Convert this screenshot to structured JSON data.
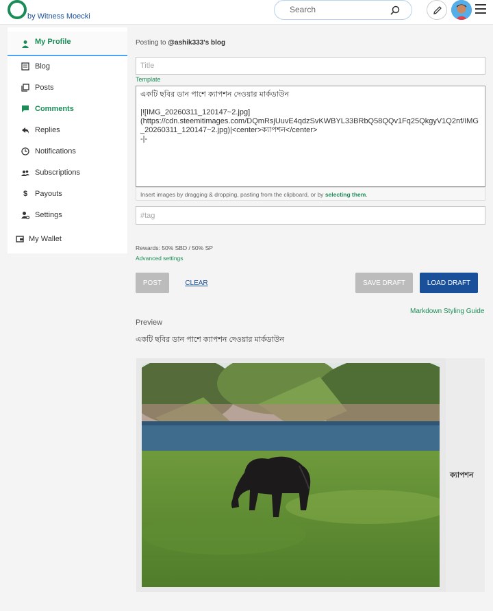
{
  "header": {
    "byline": "by Witness Moecki",
    "search_placeholder": "Search"
  },
  "sidebar": {
    "items": [
      {
        "label": "My Profile",
        "icon": "person-icon"
      },
      {
        "label": "Blog",
        "icon": "blog-icon"
      },
      {
        "label": "Posts",
        "icon": "posts-icon"
      },
      {
        "label": "Comments",
        "icon": "comment-icon"
      },
      {
        "label": "Replies",
        "icon": "reply-icon"
      },
      {
        "label": "Notifications",
        "icon": "clock-icon"
      },
      {
        "label": "Subscriptions",
        "icon": "people-icon"
      },
      {
        "label": "Payouts",
        "icon": "dollar-icon"
      },
      {
        "label": "Settings",
        "icon": "settings-icon"
      },
      {
        "label": "My Wallet",
        "icon": "wallet-icon"
      }
    ]
  },
  "editor": {
    "posting_prefix": "Posting to",
    "posting_target": "@ashik333's blog",
    "title_placeholder": "Title",
    "template_label": "Template",
    "body_text": "একটি ছবির ডান পাশে ক্যাপশন দেওয়ার মার্কডাউন\n\n|![IMG_20260311_120147~2.jpg](https://cdn.steemitimages.com/DQmRsjUuvE4qdzSvKWBYL33BRbQ58QQv1Fq25QkgyV1Q2nf/IMG_20260311_120147~2.jpg)|<center>ক্যাপশন</center>\n-|-",
    "dropzone_text": "Insert images by dragging & dropping, pasting from the clipboard, or by",
    "dropzone_link": "selecting them",
    "tags_placeholder": "#tag",
    "rewards": "Rewards: 50% SBD / 50% SP",
    "advanced_settings": "Advanced settings",
    "post_label": "Post",
    "clear_label": "Clear",
    "save_draft_label": "Save Draft",
    "load_draft_label": "Load Draft",
    "markdown_guide": "Markdown Styling Guide"
  },
  "preview": {
    "label": "Preview",
    "heading": "একটি ছবির ডান পাশে ক্যাপশন দেওয়ার মার্কডাউন",
    "caption": "ক্যাপশন"
  },
  "colors": {
    "accent_green": "#1b8c57",
    "brand_blue": "#1a5099",
    "button_gray": "#bcbcbc"
  }
}
